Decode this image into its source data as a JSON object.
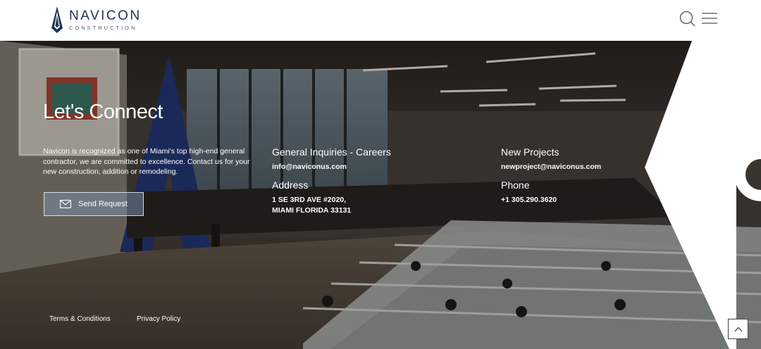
{
  "header": {
    "brand_name": "NAVICON",
    "brand_sub": "CONSTRUCTION",
    "search_icon": "search-icon",
    "menu_icon": "hamburger-menu-icon"
  },
  "hero": {
    "title": "Let's Connect",
    "intro": "Navicon is recognized as one of Miami's top high-end general contractor, we are committed to excellence. Contact us for your new construction, addition or remodeling.",
    "send_button_label": "Send Request",
    "send_button_icon": "mail-icon"
  },
  "contacts": {
    "general_label": "General Inquiries - Careers",
    "general_email": "info@naviconus.com",
    "projects_label": "New Projects",
    "projects_email": "newproject@naviconus.com",
    "address_label": "Address",
    "address_line1": "1 SE 3RD AVE #2020,",
    "address_line2": "MIAMI FLORIDA 33131",
    "phone_label": "Phone",
    "phone_value": "+1 305.290.3620"
  },
  "footer": {
    "terms": "Terms & Conditions",
    "privacy": "Privacy Policy"
  },
  "colors": {
    "brand_navy": "#1f3456",
    "button_fill": "#7a8caa"
  },
  "scroll_top_icon": "chevron-up-icon"
}
